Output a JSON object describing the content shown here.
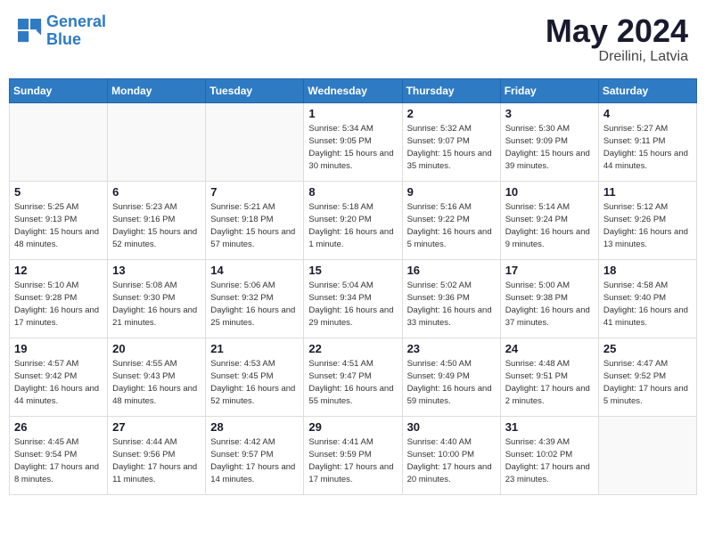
{
  "header": {
    "logo_line1": "General",
    "logo_line2": "Blue",
    "month_title": "May 2024",
    "location": "Dreilini, Latvia"
  },
  "weekdays": [
    "Sunday",
    "Monday",
    "Tuesday",
    "Wednesday",
    "Thursday",
    "Friday",
    "Saturday"
  ],
  "weeks": [
    [
      {
        "day": "",
        "info": ""
      },
      {
        "day": "",
        "info": ""
      },
      {
        "day": "",
        "info": ""
      },
      {
        "day": "1",
        "info": "Sunrise: 5:34 AM\nSunset: 9:05 PM\nDaylight: 15 hours\nand 30 minutes."
      },
      {
        "day": "2",
        "info": "Sunrise: 5:32 AM\nSunset: 9:07 PM\nDaylight: 15 hours\nand 35 minutes."
      },
      {
        "day": "3",
        "info": "Sunrise: 5:30 AM\nSunset: 9:09 PM\nDaylight: 15 hours\nand 39 minutes."
      },
      {
        "day": "4",
        "info": "Sunrise: 5:27 AM\nSunset: 9:11 PM\nDaylight: 15 hours\nand 44 minutes."
      }
    ],
    [
      {
        "day": "5",
        "info": "Sunrise: 5:25 AM\nSunset: 9:13 PM\nDaylight: 15 hours\nand 48 minutes."
      },
      {
        "day": "6",
        "info": "Sunrise: 5:23 AM\nSunset: 9:16 PM\nDaylight: 15 hours\nand 52 minutes."
      },
      {
        "day": "7",
        "info": "Sunrise: 5:21 AM\nSunset: 9:18 PM\nDaylight: 15 hours\nand 57 minutes."
      },
      {
        "day": "8",
        "info": "Sunrise: 5:18 AM\nSunset: 9:20 PM\nDaylight: 16 hours\nand 1 minute."
      },
      {
        "day": "9",
        "info": "Sunrise: 5:16 AM\nSunset: 9:22 PM\nDaylight: 16 hours\nand 5 minutes."
      },
      {
        "day": "10",
        "info": "Sunrise: 5:14 AM\nSunset: 9:24 PM\nDaylight: 16 hours\nand 9 minutes."
      },
      {
        "day": "11",
        "info": "Sunrise: 5:12 AM\nSunset: 9:26 PM\nDaylight: 16 hours\nand 13 minutes."
      }
    ],
    [
      {
        "day": "12",
        "info": "Sunrise: 5:10 AM\nSunset: 9:28 PM\nDaylight: 16 hours\nand 17 minutes."
      },
      {
        "day": "13",
        "info": "Sunrise: 5:08 AM\nSunset: 9:30 PM\nDaylight: 16 hours\nand 21 minutes."
      },
      {
        "day": "14",
        "info": "Sunrise: 5:06 AM\nSunset: 9:32 PM\nDaylight: 16 hours\nand 25 minutes."
      },
      {
        "day": "15",
        "info": "Sunrise: 5:04 AM\nSunset: 9:34 PM\nDaylight: 16 hours\nand 29 minutes."
      },
      {
        "day": "16",
        "info": "Sunrise: 5:02 AM\nSunset: 9:36 PM\nDaylight: 16 hours\nand 33 minutes."
      },
      {
        "day": "17",
        "info": "Sunrise: 5:00 AM\nSunset: 9:38 PM\nDaylight: 16 hours\nand 37 minutes."
      },
      {
        "day": "18",
        "info": "Sunrise: 4:58 AM\nSunset: 9:40 PM\nDaylight: 16 hours\nand 41 minutes."
      }
    ],
    [
      {
        "day": "19",
        "info": "Sunrise: 4:57 AM\nSunset: 9:42 PM\nDaylight: 16 hours\nand 44 minutes."
      },
      {
        "day": "20",
        "info": "Sunrise: 4:55 AM\nSunset: 9:43 PM\nDaylight: 16 hours\nand 48 minutes."
      },
      {
        "day": "21",
        "info": "Sunrise: 4:53 AM\nSunset: 9:45 PM\nDaylight: 16 hours\nand 52 minutes."
      },
      {
        "day": "22",
        "info": "Sunrise: 4:51 AM\nSunset: 9:47 PM\nDaylight: 16 hours\nand 55 minutes."
      },
      {
        "day": "23",
        "info": "Sunrise: 4:50 AM\nSunset: 9:49 PM\nDaylight: 16 hours\nand 59 minutes."
      },
      {
        "day": "24",
        "info": "Sunrise: 4:48 AM\nSunset: 9:51 PM\nDaylight: 17 hours\nand 2 minutes."
      },
      {
        "day": "25",
        "info": "Sunrise: 4:47 AM\nSunset: 9:52 PM\nDaylight: 17 hours\nand 5 minutes."
      }
    ],
    [
      {
        "day": "26",
        "info": "Sunrise: 4:45 AM\nSunset: 9:54 PM\nDaylight: 17 hours\nand 8 minutes."
      },
      {
        "day": "27",
        "info": "Sunrise: 4:44 AM\nSunset: 9:56 PM\nDaylight: 17 hours\nand 11 minutes."
      },
      {
        "day": "28",
        "info": "Sunrise: 4:42 AM\nSunset: 9:57 PM\nDaylight: 17 hours\nand 14 minutes."
      },
      {
        "day": "29",
        "info": "Sunrise: 4:41 AM\nSunset: 9:59 PM\nDaylight: 17 hours\nand 17 minutes."
      },
      {
        "day": "30",
        "info": "Sunrise: 4:40 AM\nSunset: 10:00 PM\nDaylight: 17 hours\nand 20 minutes."
      },
      {
        "day": "31",
        "info": "Sunrise: 4:39 AM\nSunset: 10:02 PM\nDaylight: 17 hours\nand 23 minutes."
      },
      {
        "day": "",
        "info": ""
      }
    ]
  ]
}
